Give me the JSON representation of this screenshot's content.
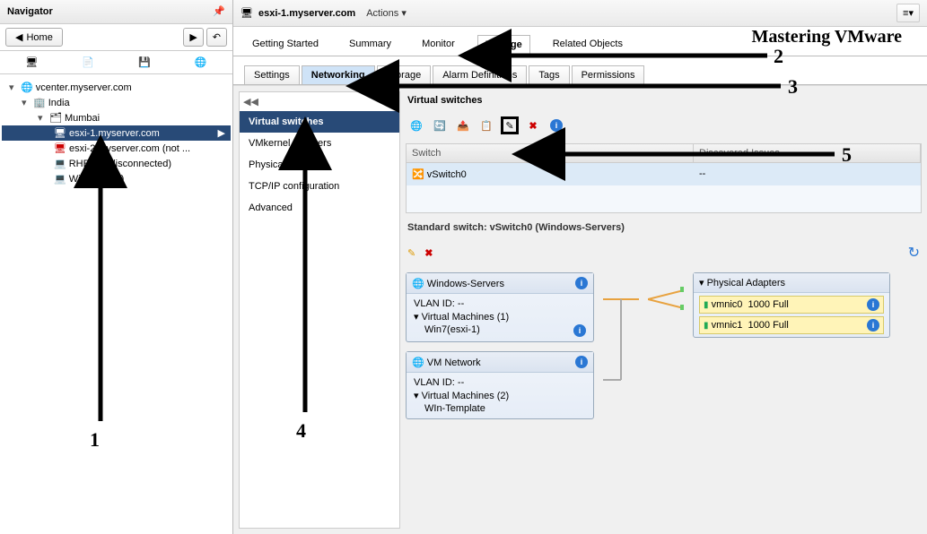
{
  "navigator": {
    "title": "Navigator",
    "home": "Home",
    "tree": {
      "root": "vcenter.myserver.com",
      "dc": "India",
      "cluster": "Mumbai",
      "hosts": [
        "esxi-1.myserver.com",
        "esxi-2.myserver.com (not ...",
        "RHEL-6 (disconnected)",
        "Win7(esxi-1)"
      ]
    }
  },
  "header": {
    "host": "esxi-1.myserver.com",
    "actions": "Actions"
  },
  "watermark": "Mastering VMware",
  "tabs1": [
    "Getting Started",
    "Summary",
    "Monitor",
    "Manage",
    "Related Objects"
  ],
  "tabs2": [
    "Settings",
    "Networking",
    "Storage",
    "Alarm Definitions",
    "Tags",
    "Permissions"
  ],
  "leftmenu": [
    "Virtual switches",
    "VMkernel adapters",
    "Physical adapters",
    "TCP/IP configuration",
    "Advanced"
  ],
  "vswitch_table": {
    "title": "Virtual switches",
    "columns": [
      "Switch",
      "Discovered Issues"
    ],
    "row": {
      "switch": "vSwitch0",
      "issues": "--"
    }
  },
  "std": {
    "title": "Standard switch: vSwitch0 (Windows-Servers)"
  },
  "pg1": {
    "name": "Windows-Servers",
    "vlan": "VLAN ID: --",
    "vms_label": "Virtual Machines (1)",
    "vm1": "Win7(esxi-1)"
  },
  "pg2": {
    "name": "VM Network",
    "vlan": "VLAN ID: --",
    "vms_label": "Virtual Machines (2)",
    "vm1": "WIn-Template"
  },
  "phys": {
    "title": "Physical Adapters",
    "nics": [
      {
        "name": "vmnic0",
        "speed": "1000  Full"
      },
      {
        "name": "vmnic1",
        "speed": "1000  Full"
      }
    ]
  },
  "annot": {
    "a1": "1",
    "a2": "2",
    "a3": "3",
    "a4": "4",
    "a5": "5"
  }
}
